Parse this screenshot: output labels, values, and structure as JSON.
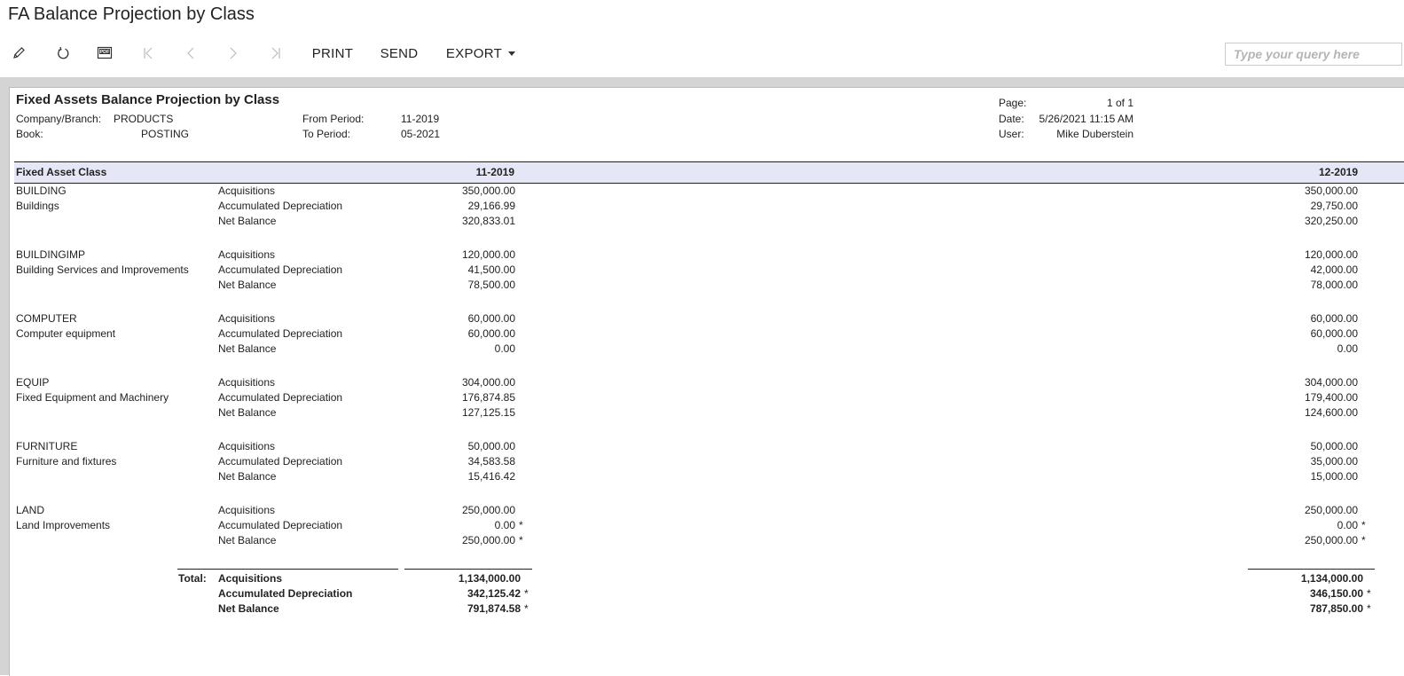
{
  "app": {
    "title": "FA Balance Projection by Class"
  },
  "toolbar": {
    "edit_icon": "pencil-icon",
    "refresh_icon": "refresh-icon",
    "pdf_icon": "pdf-icon",
    "first_icon": "first-page-icon",
    "prev_icon": "previous-page-icon",
    "next_icon": "next-page-icon",
    "last_icon": "last-page-icon",
    "print_label": "PRINT",
    "send_label": "SEND",
    "export_label": "EXPORT",
    "export_icon": "caret-down-icon"
  },
  "search": {
    "placeholder": "Type your query here",
    "value": ""
  },
  "report": {
    "title": "Fixed Assets Balance Projection by Class",
    "company_label": "Company/Branch:",
    "company_value": "PRODUCTS",
    "book_label": "Book:",
    "book_value": "POSTING",
    "from_label": "From Period:",
    "from_value": "11-2019",
    "to_label": "To Period:",
    "to_value": "05-2021",
    "page_label": "Page:",
    "page_value": "1 of 1",
    "date_label": "Date:",
    "date_value": "5/26/2021 11:15 AM",
    "user_label": "User:",
    "user_value": "Mike Duberstein",
    "header": {
      "class_col": "Fixed Asset Class",
      "period1": "11-2019",
      "period2": "12-2019"
    },
    "classes": [
      {
        "code": "BUILDING",
        "desc": "Buildings",
        "rows": [
          {
            "label": "Acquisitions",
            "p1": "350,000.00",
            "p2": "350,000.00"
          },
          {
            "label": "Accumulated Depreciation",
            "p1": "29,166.99",
            "p2": "29,750.00"
          },
          {
            "label": "Net Balance",
            "p1": "320,833.01",
            "p2": "320,250.00"
          }
        ]
      },
      {
        "code": "BUILDINGIMP",
        "desc": "Building Services and Improvements",
        "rows": [
          {
            "label": "Acquisitions",
            "p1": "120,000.00",
            "p2": "120,000.00"
          },
          {
            "label": "Accumulated Depreciation",
            "p1": "41,500.00",
            "p2": "42,000.00"
          },
          {
            "label": "Net Balance",
            "p1": "78,500.00",
            "p2": "78,000.00"
          }
        ]
      },
      {
        "code": "COMPUTER",
        "desc": "Computer equipment",
        "rows": [
          {
            "label": "Acquisitions",
            "p1": "60,000.00",
            "p2": "60,000.00"
          },
          {
            "label": "Accumulated Depreciation",
            "p1": "60,000.00",
            "p2": "60,000.00"
          },
          {
            "label": "Net Balance",
            "p1": "0.00",
            "p2": "0.00"
          }
        ]
      },
      {
        "code": "EQUIP",
        "desc": "Fixed Equipment and Machinery",
        "rows": [
          {
            "label": "Acquisitions",
            "p1": "304,000.00",
            "p2": "304,000.00"
          },
          {
            "label": "Accumulated Depreciation",
            "p1": "176,874.85",
            "p2": "179,400.00"
          },
          {
            "label": "Net Balance",
            "p1": "127,125.15",
            "p2": "124,600.00"
          }
        ]
      },
      {
        "code": "FURNITURE",
        "desc": "Furniture and fixtures",
        "rows": [
          {
            "label": "Acquisitions",
            "p1": "50,000.00",
            "p2": "50,000.00"
          },
          {
            "label": "Accumulated Depreciation",
            "p1": "34,583.58",
            "p2": "35,000.00"
          },
          {
            "label": "Net Balance",
            "p1": "15,416.42",
            "p2": "15,000.00"
          }
        ]
      },
      {
        "code": "LAND",
        "desc": "Land Improvements",
        "rows": [
          {
            "label": "Acquisitions",
            "p1": "250,000.00",
            "p2": "250,000.00"
          },
          {
            "label": "Accumulated Depreciation",
            "p1": "0.00",
            "p2": "0.00",
            "p1_mark": "*",
            "p2_mark": "*"
          },
          {
            "label": "Net Balance",
            "p1": "250,000.00",
            "p2": "250,000.00",
            "p1_mark": "*",
            "p2_mark": "*"
          }
        ]
      }
    ],
    "totals": {
      "label": "Total:",
      "rows": [
        {
          "label": "Acquisitions",
          "p1": "1,134,000.00",
          "p2": "1,134,000.00"
        },
        {
          "label": "Accumulated Depreciation",
          "p1": "342,125.42",
          "p2": "346,150.00",
          "p1_mark": "*",
          "p2_mark": "*"
        },
        {
          "label": "Net Balance",
          "p1": "791,874.58",
          "p2": "787,850.00",
          "p1_mark": "*",
          "p2_mark": "*"
        }
      ]
    }
  }
}
